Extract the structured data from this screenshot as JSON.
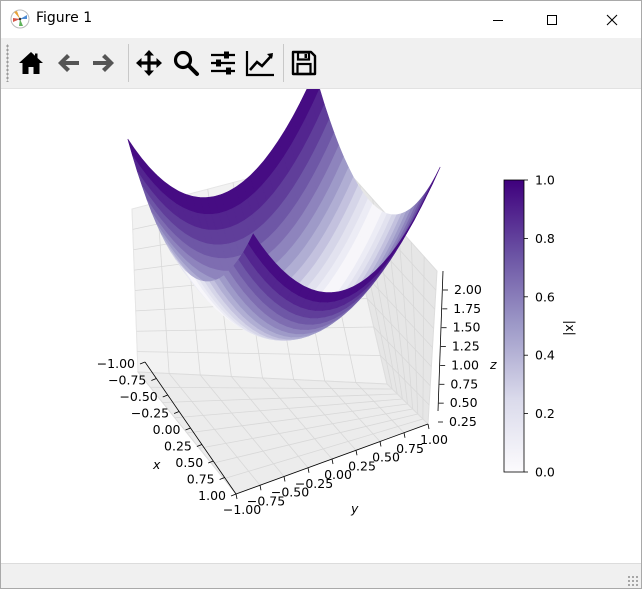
{
  "window": {
    "title": "Figure 1"
  },
  "toolbar": {
    "buttons": [
      {
        "name": "home",
        "icon": "home-icon"
      },
      {
        "name": "back",
        "icon": "arrow-left-icon"
      },
      {
        "name": "forward",
        "icon": "arrow-right-icon"
      },
      {
        "name": "pan",
        "icon": "move-icon"
      },
      {
        "name": "zoom",
        "icon": "magnifier-icon"
      },
      {
        "name": "subplots",
        "icon": "sliders-icon"
      },
      {
        "name": "customize",
        "icon": "line-chart-icon"
      },
      {
        "name": "save",
        "icon": "floppy-disk-icon"
      }
    ]
  },
  "chart_data": {
    "type": "surface",
    "function": "z = x^2 + y^2",
    "color_by": "|x|",
    "colormap": "Purples",
    "xlabel": "x",
    "ylabel": "y",
    "zlabel": "z",
    "xlim": [
      -1.0,
      1.0
    ],
    "ylim": [
      -1.0,
      1.0
    ],
    "zlim": [
      0.0,
      2.0
    ],
    "x_ticks": [
      "−1.00",
      "−0.75",
      "−0.50",
      "−0.25",
      "0.00",
      "0.25",
      "0.50",
      "0.75",
      "1.00"
    ],
    "y_ticks": [
      "−1.00",
      "−0.75",
      "−0.50",
      "−0.25",
      "0.00",
      "0.25",
      "0.50",
      "0.75",
      "1.00"
    ],
    "z_ticks": [
      "0.25",
      "0.50",
      "0.75",
      "1.00",
      "1.25",
      "1.50",
      "1.75",
      "2.00"
    ],
    "colorbar": {
      "label": "|x|",
      "range": [
        0.0,
        1.0
      ],
      "ticks": [
        "0.0",
        "0.2",
        "0.4",
        "0.6",
        "0.8",
        "1.0"
      ],
      "colors": [
        "#fcfbfd",
        "#dadaeb",
        "#9e9ac8",
        "#6a51a3",
        "#3f007d"
      ]
    }
  }
}
